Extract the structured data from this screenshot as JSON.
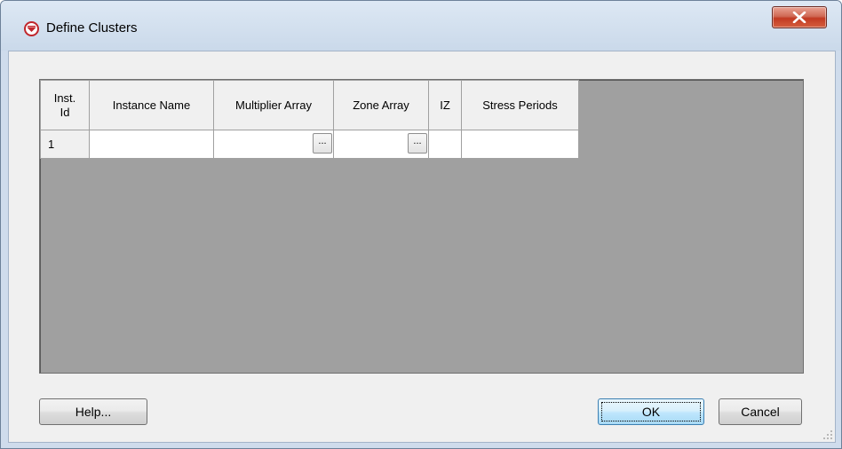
{
  "window": {
    "title": "Define Clusters"
  },
  "grid": {
    "columns": [
      "Inst.\nId",
      "Instance Name",
      "Multiplier Array",
      "Zone Array",
      "IZ",
      "Stress Periods"
    ],
    "rows": [
      {
        "inst_id": "1",
        "instance_name": "",
        "multiplier_array": "",
        "zone_array": "",
        "iz": "",
        "stress_periods": ""
      }
    ],
    "ellipsis_label": "..."
  },
  "buttons": {
    "help": "Help...",
    "ok": "OK",
    "cancel": "Cancel"
  },
  "colors": {
    "grid_background": "#a0a0a0",
    "dialog_background": "#f0f0f0",
    "close_button": "#c23a22"
  },
  "icons": [
    "app-logo-icon",
    "close-icon",
    "resize-grip-icon"
  ]
}
